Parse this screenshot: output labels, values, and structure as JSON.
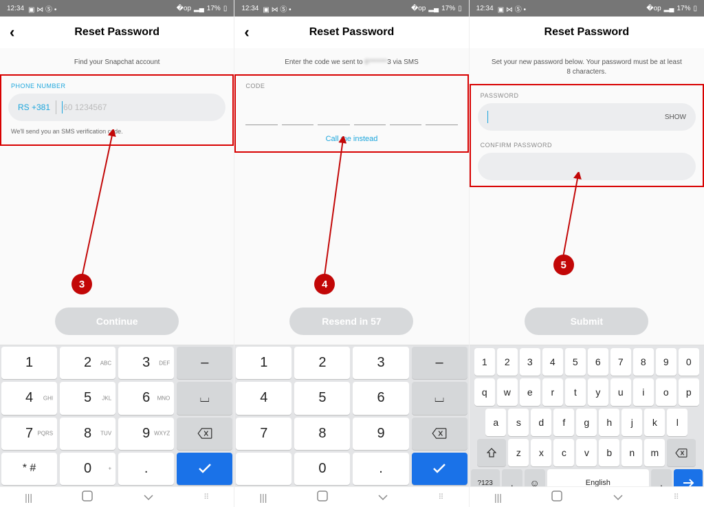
{
  "statusbar": {
    "time": "12:34",
    "battery_pct": "17%"
  },
  "screens": {
    "s3": {
      "title": "Reset Password",
      "subtitle": "Find your Snapchat account",
      "phone_label": "PHONE NUMBER",
      "cc_prefix": "RS +381",
      "placeholder": "60 1234567",
      "hint": "We'll send you an SMS verification code.",
      "button": "Continue",
      "step": "3"
    },
    "s4": {
      "title": "Reset Password",
      "subtitle_pre": "Enter the code we sent to ",
      "subtitle_blur": "6*******",
      "subtitle_post": "3 via SMS",
      "code_label": "CODE",
      "link": "Call me instead",
      "button": "Resend in 57",
      "step": "4"
    },
    "s5": {
      "title": "Reset Password",
      "subtitle": "Set your new password below. Your password must be at least 8 characters.",
      "pwd_label": "PASSWORD",
      "show": "SHOW",
      "confirm_label": "CONFIRM PASSWORD",
      "button": "Submit",
      "step": "5"
    }
  },
  "numpad": {
    "keys": [
      [
        "1",
        ""
      ],
      [
        "2",
        "ABC"
      ],
      [
        "3",
        "DEF"
      ],
      [
        "–",
        ""
      ],
      [
        "4",
        "GHI"
      ],
      [
        "5",
        "JKL"
      ],
      [
        "6",
        "MNO"
      ],
      [
        "␣",
        ""
      ],
      [
        "7",
        "PQRS"
      ],
      [
        "8",
        "TUV"
      ],
      [
        "9",
        "WXYZ"
      ],
      [
        "⌫",
        ""
      ],
      [
        "* #",
        ""
      ],
      [
        "0",
        "+"
      ],
      [
        ".",
        ""
      ],
      [
        "✓",
        ""
      ]
    ]
  },
  "qwerty": {
    "row0": [
      "1",
      "2",
      "3",
      "4",
      "5",
      "6",
      "7",
      "8",
      "9",
      "0"
    ],
    "row1": [
      "q",
      "w",
      "e",
      "r",
      "t",
      "y",
      "u",
      "i",
      "o",
      "p"
    ],
    "row2": [
      "a",
      "s",
      "d",
      "f",
      "g",
      "h",
      "j",
      "k",
      "l"
    ],
    "row3_shift": "⇧",
    "row3": [
      "z",
      "x",
      "c",
      "v",
      "b",
      "n",
      "m"
    ],
    "row3_bksp": "⌫",
    "row4_sym": "?123",
    "row4_comma": ",",
    "row4_space": "English",
    "row4_dot": ".",
    "row4_enter": "→"
  },
  "nav": {
    "recents": "|||",
    "home": "◯",
    "back": "⌄",
    "kbd": "⌨"
  }
}
